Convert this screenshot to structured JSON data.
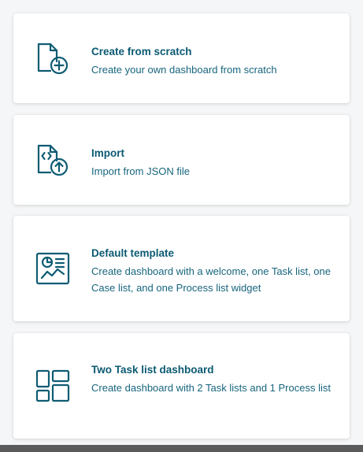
{
  "options": [
    {
      "title": "Create from scratch",
      "description": "Create your own dashboard from scratch",
      "icon": "file-plus-icon"
    },
    {
      "title": "Import",
      "description": "Import from JSON file",
      "icon": "file-code-upload-icon"
    },
    {
      "title": "Default template",
      "description": "Create dashboard with a welcome, one Task list, one Case list, and one Process list widget",
      "icon": "chart-template-icon"
    },
    {
      "title": "Two Task list dashboard",
      "description": "Create dashboard with 2 Task lists and 1 Process list",
      "icon": "layout-grid-icon"
    }
  ],
  "colors": {
    "accent": "#0b5a73",
    "card_background": "#ffffff",
    "page_background": "#f5f6f7"
  }
}
